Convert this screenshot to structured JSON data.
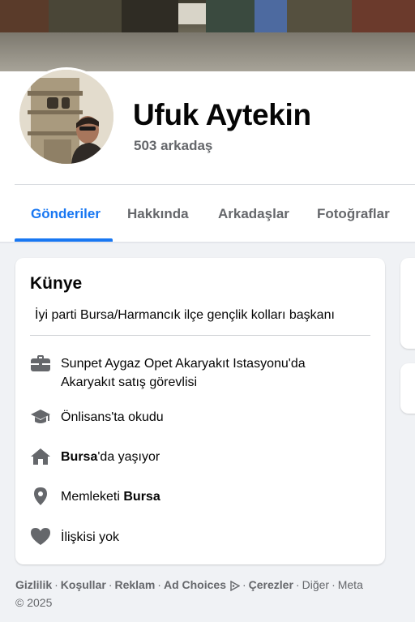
{
  "profile": {
    "name": "Ufuk Aytekin",
    "friends": "503 arkadaş"
  },
  "tabs": [
    {
      "label": "Gönderiler",
      "active": true
    },
    {
      "label": "Hakkında",
      "active": false
    },
    {
      "label": "Arkadaşlar",
      "active": false
    },
    {
      "label": "Fotoğraflar",
      "active": false
    }
  ],
  "intro": {
    "title": "Künye",
    "bio": "İyi parti Bursa/Harmancık ilçe gençlik kolları başkanı",
    "items": [
      {
        "icon": "briefcase-icon",
        "text_line1": "Sunpet Aygaz Opet Akaryakıt Istasyonu'da",
        "text_line2": "Akaryakıt satış görevlisi"
      },
      {
        "icon": "graduation-cap-icon",
        "text": "Önlisans'ta okudu"
      },
      {
        "icon": "home-icon",
        "bold": "Bursa",
        "text": "'da yaşıyor"
      },
      {
        "icon": "location-pin-icon",
        "text": "Memleketi ",
        "bold": "Bursa"
      },
      {
        "icon": "heart-icon",
        "text": "İlişkisi yok"
      }
    ]
  },
  "footer": {
    "links": [
      "Gizlilik",
      "Koşullar",
      "Reklam",
      "Ad Choices",
      "Çerezler"
    ],
    "more": "Diğer",
    "separator": "·",
    "meta_line1": "Meta",
    "meta_line2": "© 2025"
  },
  "colors": {
    "accent": "#1877f2",
    "secondary_text": "#65676b",
    "background": "#f0f2f5",
    "icon_gray": "#65676b"
  }
}
